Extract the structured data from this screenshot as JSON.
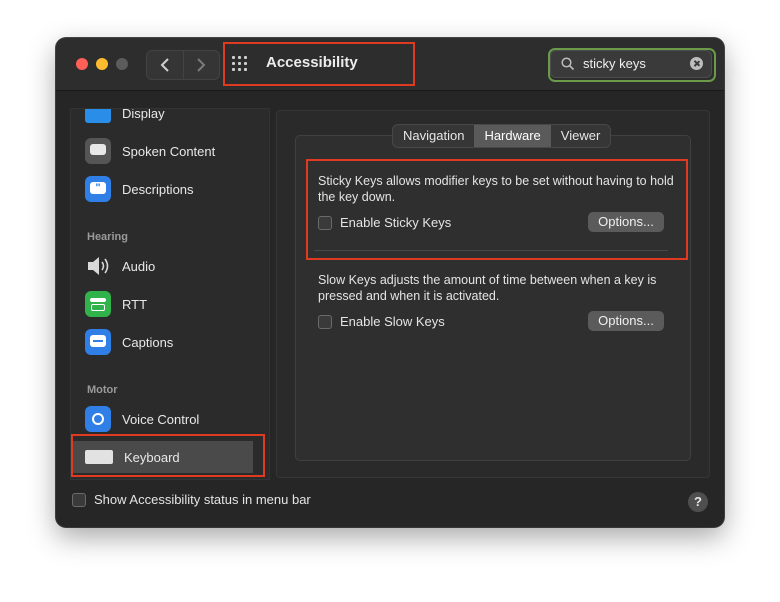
{
  "window": {
    "title": "Accessibility"
  },
  "search": {
    "value": "sticky keys"
  },
  "sidebar": {
    "items": [
      {
        "label": "Display",
        "icon": "display-icon"
      },
      {
        "label": "Spoken Content",
        "icon": "speech-bubble-icon"
      },
      {
        "label": "Descriptions",
        "icon": "quote-bubble-icon"
      },
      {
        "label": "Audio",
        "icon": "speaker-icon"
      },
      {
        "label": "RTT",
        "icon": "tty-phone-icon"
      },
      {
        "label": "Captions",
        "icon": "captions-icon"
      },
      {
        "label": "Voice Control",
        "icon": "voice-control-icon"
      },
      {
        "label": "Keyboard",
        "icon": "keyboard-icon"
      }
    ],
    "sections": {
      "hearing": "Hearing",
      "motor": "Motor"
    }
  },
  "tabs": {
    "items": [
      "Navigation",
      "Hardware",
      "Viewer"
    ],
    "selected": "Hardware"
  },
  "sticky_keys": {
    "description": "Sticky Keys allows modifier keys to be set without having to hold the key down.",
    "checkbox_label": "Enable Sticky Keys",
    "options_label": "Options..."
  },
  "slow_keys": {
    "description": "Slow Keys adjusts the amount of time between when a key is pressed and when it is activated.",
    "checkbox_label": "Enable Slow Keys",
    "options_label": "Options..."
  },
  "footer": {
    "status_label": "Show Accessibility status in menu bar",
    "help_label": "?"
  },
  "colors": {
    "highlight": "#e03a20",
    "search_highlight": "#6a9a4a",
    "blue_icon": "#2f7fe6",
    "green_icon": "#31b24a"
  }
}
